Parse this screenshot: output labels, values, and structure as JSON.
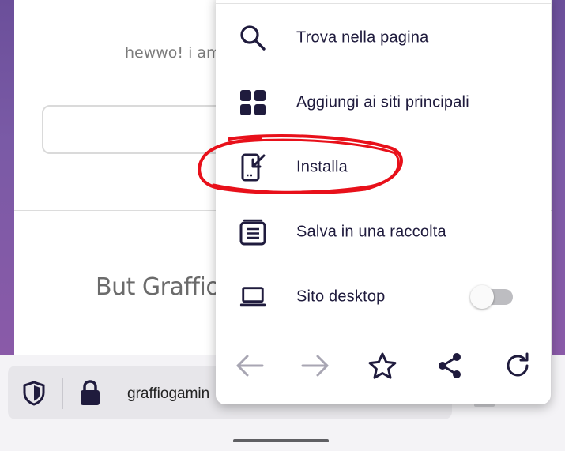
{
  "page": {
    "greeting_text": "hewwo! i am",
    "heading_text": "But Graffio,",
    "input_value": ""
  },
  "toolbar": {
    "url_text": "graffiogamin",
    "shield_icon": "tracking-protection-shield-icon",
    "lock_icon": "lock-icon"
  },
  "menu": {
    "items": [
      {
        "label": "Trova nella pagina",
        "icon": "search-icon"
      },
      {
        "label": "Aggiungi ai siti principali",
        "icon": "grid-icon"
      },
      {
        "label": "Installa",
        "icon": "install-phone-icon"
      },
      {
        "label": "Salva in una raccolta",
        "icon": "collection-icon"
      },
      {
        "label": "Sito desktop",
        "icon": "laptop-icon",
        "toggle": false
      }
    ],
    "nav": [
      {
        "name": "back",
        "icon": "arrow-left-icon",
        "enabled": false
      },
      {
        "name": "forward",
        "icon": "arrow-right-icon",
        "enabled": false
      },
      {
        "name": "bookmark",
        "icon": "star-icon",
        "enabled": true
      },
      {
        "name": "share",
        "icon": "share-icon",
        "enabled": true
      },
      {
        "name": "reload",
        "icon": "reload-icon",
        "enabled": true
      }
    ]
  },
  "colors": {
    "menu_text": "#1f1b3d",
    "icon": "#1f1b3d",
    "disabled_icon": "#a8a6b3",
    "annotation_red": "#e8101a",
    "background_purple": "#7a5aa6"
  }
}
